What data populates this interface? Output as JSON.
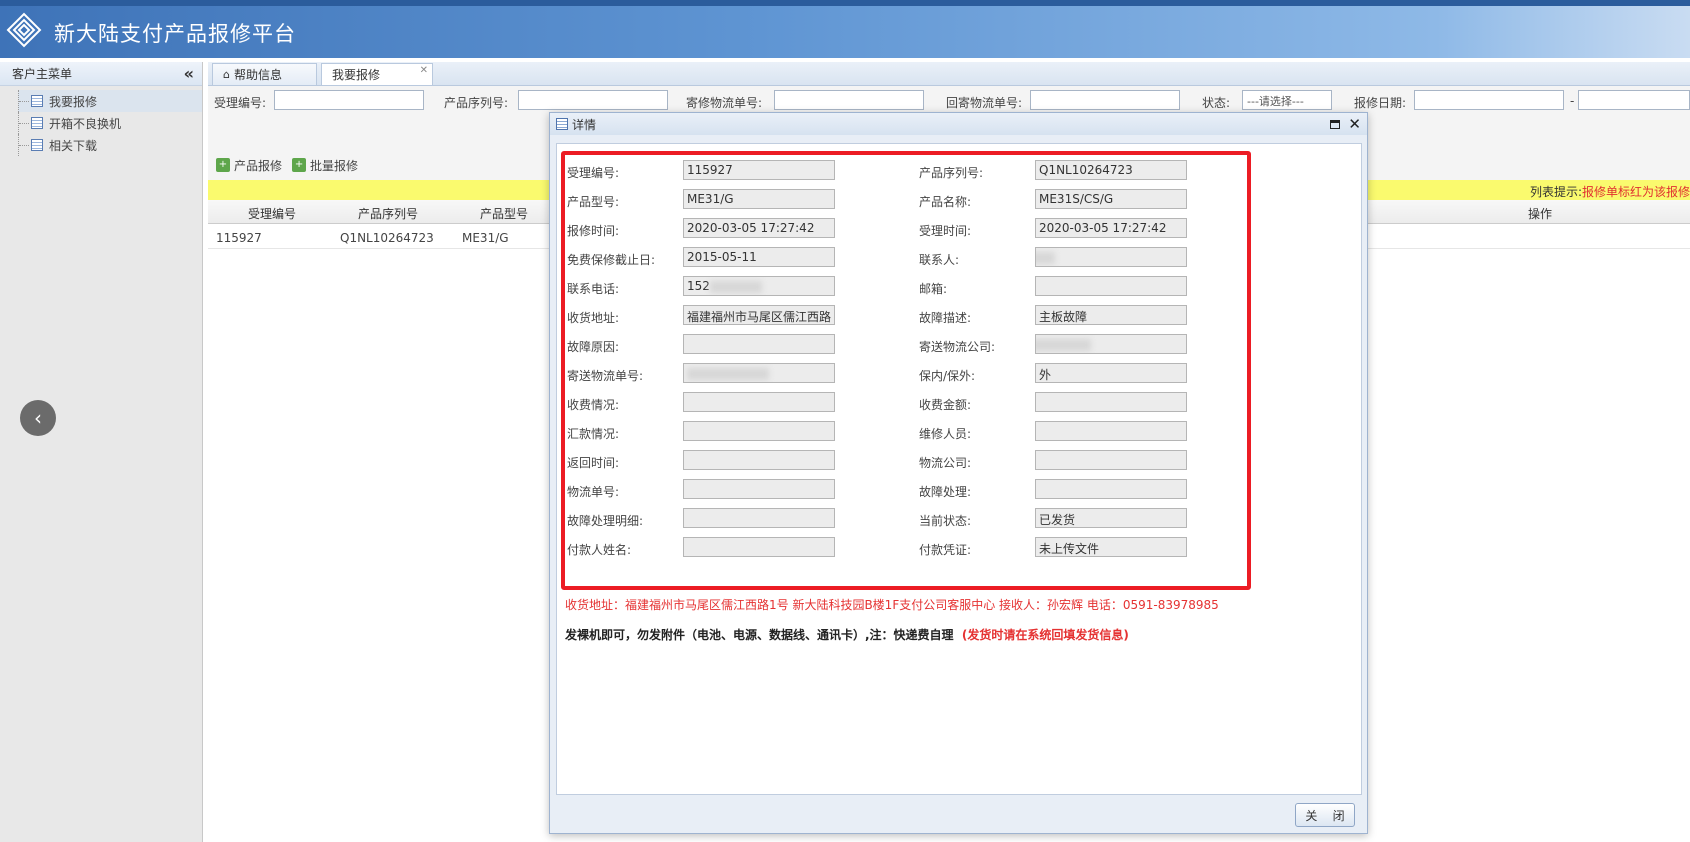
{
  "app": {
    "title": "新大陆支付产品报修平台"
  },
  "sidebar": {
    "title": "客户主菜单",
    "items": [
      {
        "label": "我要报修"
      },
      {
        "label": "开箱不良换机"
      },
      {
        "label": "相关下载"
      }
    ]
  },
  "tabs": [
    {
      "label": "帮助信息"
    },
    {
      "label": "我要报修"
    }
  ],
  "filters": {
    "accept_no": "受理编号:",
    "serial_no": "产品序列号:",
    "send_tracking": "寄修物流单号:",
    "return_tracking": "回寄物流单号:",
    "status": "状态:",
    "status_placeholder": "---请选择---",
    "report_date": "报修日期:",
    "date_sep": "-"
  },
  "toolbar": {
    "product_repair": "产品报修",
    "batch_repair": "批量报修"
  },
  "hint": {
    "label": "列表提示:",
    "text": "报修单标红为该报修"
  },
  "grid": {
    "headers": [
      "受理编号",
      "产品序列号",
      "产品型号",
      "操作"
    ],
    "rows": [
      {
        "accept_no": "115927",
        "serial_no": "Q1NL10264723",
        "model": "ME31/G"
      }
    ]
  },
  "modal": {
    "title": "详情",
    "close_button": "关 闭",
    "fields_left": [
      {
        "label": "受理编号:",
        "value": "115927"
      },
      {
        "label": "产品型号:",
        "value": "ME31/G"
      },
      {
        "label": "报修时间:",
        "value": "2020-03-05 17:27:42"
      },
      {
        "label": "免费保修截止日:",
        "value": "2015-05-11"
      },
      {
        "label": "联系电话:",
        "value": "152"
      },
      {
        "label": "收货地址:",
        "value": "福建福州市马尾区儒江西路"
      },
      {
        "label": "故障原因:",
        "value": ""
      },
      {
        "label": "寄送物流单号:",
        "value": ""
      },
      {
        "label": "收费情况:",
        "value": ""
      },
      {
        "label": "汇款情况:",
        "value": ""
      },
      {
        "label": "返回时间:",
        "value": ""
      },
      {
        "label": "物流单号:",
        "value": ""
      },
      {
        "label": "故障处理明细:",
        "value": ""
      },
      {
        "label": "付款人姓名:",
        "value": ""
      }
    ],
    "fields_right": [
      {
        "label": "产品序列号:",
        "value": "Q1NL10264723"
      },
      {
        "label": "产品名称:",
        "value": "ME31S/CS/G"
      },
      {
        "label": "受理时间:",
        "value": "2020-03-05 17:27:42"
      },
      {
        "label": "联系人:",
        "value": ""
      },
      {
        "label": "邮箱:",
        "value": ""
      },
      {
        "label": "故障描述:",
        "value": "主板故障"
      },
      {
        "label": "寄送物流公司:",
        "value": ""
      },
      {
        "label": "保内/保外:",
        "value": "外"
      },
      {
        "label": "收费金额:",
        "value": ""
      },
      {
        "label": "维修人员:",
        "value": ""
      },
      {
        "label": "物流公司:",
        "value": ""
      },
      {
        "label": "故障处理:",
        "value": ""
      },
      {
        "label": "当前状态:",
        "value": "已发货"
      },
      {
        "label": "付款凭证:",
        "value": "未上传文件"
      }
    ],
    "address_note": "收货地址：福建福州市马尾区儒江西路1号 新大陆科技园B楼1F支付公司客服中心 接收人：孙宏辉 电话：0591-83978985",
    "shipping_note": "发裸机即可，勿发附件（电池、电源、数据线、通讯卡）,注：快递费自理",
    "shipping_warning": "(发货时请在系统回填发货信息)"
  },
  "colors": {
    "highlight": "#ec1c24",
    "hint_bg": "#fafa6e",
    "header_blue": "#3e73b8"
  }
}
